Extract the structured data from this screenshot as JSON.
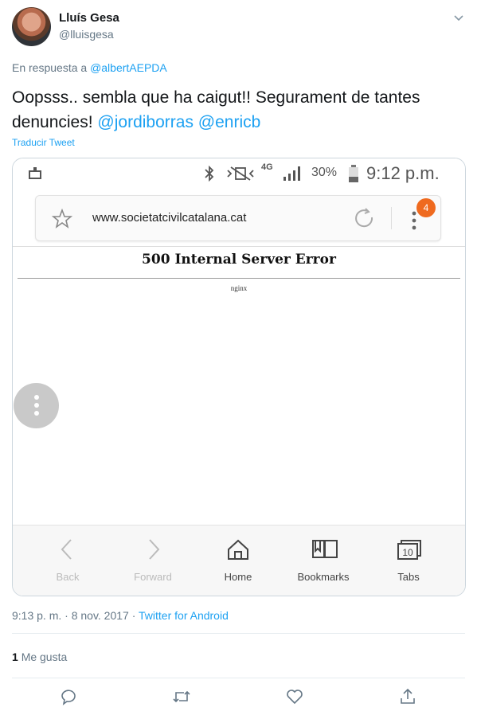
{
  "author": {
    "name": "Lluís Gesa",
    "handle": "@lluisgesa"
  },
  "reply_to": {
    "prefix": "En respuesta a",
    "mention": "@albertAEPDA"
  },
  "tweet": {
    "text": "Oopsss.. sembla que ha caigut!! Segurament de tantes denuncies!",
    "mentions": [
      "@jordiborras",
      "@enricb"
    ]
  },
  "translate_label": "Traducir Tweet",
  "screenshot": {
    "status": {
      "network": "4G",
      "battery": "30%",
      "time": "9:12 p.m."
    },
    "url": "www.societatcivilcatalana.cat",
    "menu_badge": "4",
    "error_title": "500 Internal Server Error",
    "server": "nginx",
    "nav": [
      {
        "label": "Back",
        "icon": "back-arrow-icon"
      },
      {
        "label": "Forward",
        "icon": "forward-arrow-icon"
      },
      {
        "label": "Home",
        "icon": "home-icon"
      },
      {
        "label": "Bookmarks",
        "icon": "bookmarks-icon"
      },
      {
        "label": "Tabs",
        "icon": "tabs-icon",
        "count": "10"
      }
    ]
  },
  "meta": {
    "time_date": "9:13 p. m. · 8 nov. 2017 ·",
    "source": "Twitter for Android"
  },
  "likes": {
    "count": "1",
    "label": "Me gusta"
  },
  "colors": {
    "link": "#1da1f2",
    "badge": "#ef6a1f",
    "muted": "#657786"
  }
}
